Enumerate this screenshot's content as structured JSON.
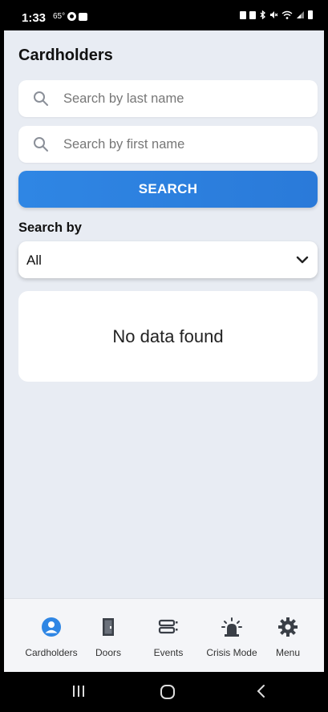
{
  "status_bar": {
    "time": "1:33",
    "temperature": "65°",
    "left_icons": [
      "notification-dot-icon",
      "gallery-icon"
    ],
    "right_icons": [
      "battery-saver-icon",
      "alarm-icon",
      "bluetooth-icon",
      "mute-icon",
      "wifi-icon",
      "signal-icon",
      "battery-icon"
    ]
  },
  "page": {
    "title": "Cardholders"
  },
  "search": {
    "last_name_placeholder": "Search by last name",
    "first_name_placeholder": "Search by first name",
    "button_label": "SEARCH"
  },
  "filter": {
    "label": "Search by",
    "selected": "All"
  },
  "results": {
    "empty_message": "No data found"
  },
  "bottom_nav": {
    "items": [
      {
        "label": "Cardholders",
        "icon": "person-circle-icon",
        "active": true
      },
      {
        "label": "Doors",
        "icon": "door-icon",
        "active": false
      },
      {
        "label": "Events",
        "icon": "events-icon",
        "active": false
      },
      {
        "label": "Crisis Mode",
        "icon": "alarm-light-icon",
        "active": false
      },
      {
        "label": "Menu",
        "icon": "gear-icon",
        "active": false
      }
    ]
  },
  "system_nav": {
    "icons": [
      "recent-apps-icon",
      "home-icon",
      "back-icon"
    ]
  },
  "colors": {
    "accent": "#2f86e4",
    "background": "#e8ecf3",
    "active_nav": "#2f86e4"
  }
}
